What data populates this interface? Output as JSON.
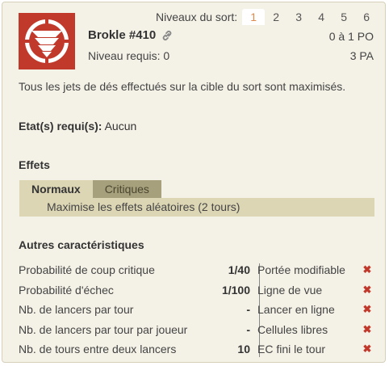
{
  "levels": {
    "label": "Niveaux du sort:",
    "items": [
      "1",
      "2",
      "3",
      "4",
      "5",
      "6"
    ],
    "active_index": 0
  },
  "spell": {
    "name": "Brokle #410",
    "required_level": "Niveau requis: 0",
    "range": "0 à 1 PO",
    "ap": "3 PA",
    "description": "Tous les jets de dés effectués sur la cible du sort sont maximisés.",
    "required_states_label": "Etat(s) requi(s):",
    "required_states_value": "Aucun"
  },
  "effects": {
    "title": "Effets",
    "tabs": [
      "Normaux",
      "Critiques"
    ],
    "active_tab": "Normaux",
    "normal": [
      "Maximise les effets aléatoires (2 tours)"
    ]
  },
  "characteristics": {
    "title": "Autres caractéristiques",
    "left": [
      {
        "label": "Probabilité de coup critique",
        "value": "1/40"
      },
      {
        "label": "Probabilité d'échec",
        "value": "1/100"
      },
      {
        "label": "Nb. de lancers par tour",
        "value": "-"
      },
      {
        "label": "Nb. de lancers par tour par joueur",
        "value": "-"
      },
      {
        "label": "Nb. de tours entre deux lancers",
        "value": "10"
      }
    ],
    "right": [
      {
        "label": "Portée modifiable",
        "icon": "cross-icon"
      },
      {
        "label": "Ligne de vue",
        "icon": "cross-icon"
      },
      {
        "label": "Lancer en ligne",
        "icon": "cross-icon"
      },
      {
        "label": "Cellules libres",
        "icon": "cross-icon"
      },
      {
        "label": "EC fini le tour",
        "icon": "cross-icon"
      }
    ]
  },
  "colors": {
    "accent": "#e2894c",
    "cross": "#c0392b",
    "tab_active": "#dcd6b5",
    "tab_inactive": "#a7a07c"
  }
}
